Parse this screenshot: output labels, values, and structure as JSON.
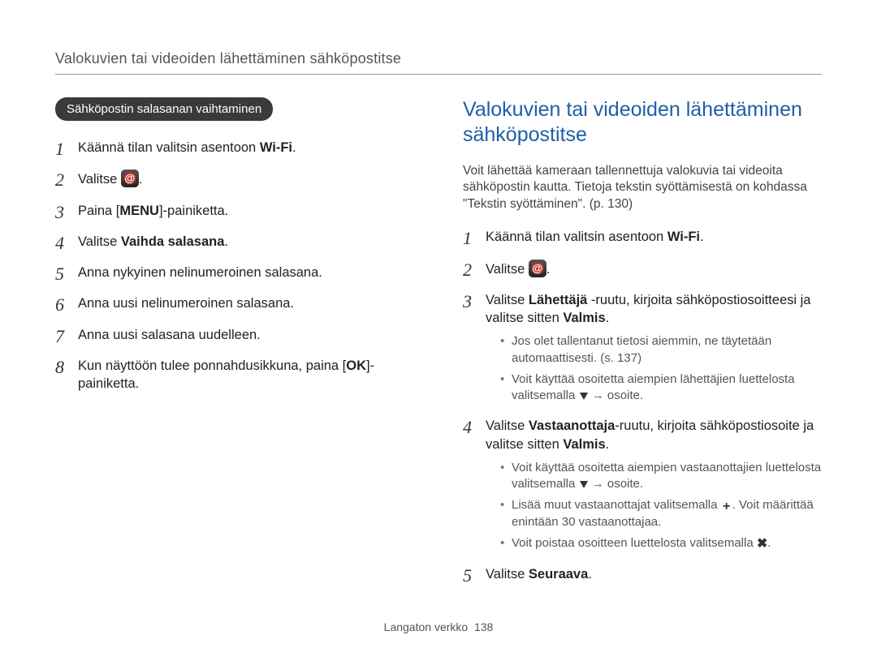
{
  "header": "Valokuvien tai videoiden lähettäminen sähköpostitse",
  "left": {
    "pill": "Sähköpostin salasanan vaihtaminen",
    "steps": {
      "s1_a": "Käännä tilan valitsin asentoon ",
      "s1_wifi": "Wi-Fi",
      "s1_b": ".",
      "s2_a": "Valitse ",
      "s2_b": ".",
      "s3_a": "Paina [",
      "s3_menu": "MENU",
      "s3_b": "]-painiketta.",
      "s4_a": "Valitse ",
      "s4_bold": "Vaihda salasana",
      "s4_b": ".",
      "s5": "Anna nykyinen nelinumeroinen salasana.",
      "s6": "Anna uusi nelinumeroinen salasana.",
      "s7": "Anna uusi salasana uudelleen.",
      "s8_a": "Kun näyttöön tulee ponnahdusikkuna, paina [",
      "s8_ok": "OK",
      "s8_b": "]-painiketta."
    }
  },
  "right": {
    "title": "Valokuvien tai videoiden lähettäminen sähköpostitse",
    "intro": "Voit lähettää kameraan tallennettuja valokuvia tai videoita sähköpostin kautta. Tietoja tekstin syöttämisestä on kohdassa \"Tekstin syöttäminen\". (p. 130)",
    "steps": {
      "s1_a": "Käännä tilan valitsin asentoon ",
      "s1_wifi": "Wi-Fi",
      "s1_b": ".",
      "s2_a": "Valitse ",
      "s2_b": ".",
      "s3_a": "Valitse ",
      "s3_bold1": "Lähettäjä",
      "s3_b": " -ruutu, kirjoita sähköpostiosoitteesi ja valitse sitten ",
      "s3_bold2": "Valmis",
      "s3_c": ".",
      "s3_sub1": "Jos olet tallentanut tietosi aiemmin, ne täytetään automaattisesti. (s. 137)",
      "s3_sub2_a": "Voit käyttää osoitetta aiempien lähettäjien luettelosta valitsemalla ",
      "s3_sub2_b": " → osoite.",
      "s4_a": "Valitse ",
      "s4_bold1": "Vastaanottaja",
      "s4_b": "-ruutu, kirjoita sähköpostiosoite ja valitse sitten ",
      "s4_bold2": "Valmis",
      "s4_c": ".",
      "s4_sub1_a": "Voit käyttää osoitetta aiempien vastaanottajien luettelosta valitsemalla ",
      "s4_sub1_b": " → osoite.",
      "s4_sub2_a": "Lisää muut vastaanottajat valitsemalla ",
      "s4_sub2_b": ". Voit määrittää enintään 30 vastaanottajaa.",
      "s4_sub3_a": "Voit poistaa osoitteen luettelosta valitsemalla ",
      "s4_sub3_b": ".",
      "s5_a": "Valitse ",
      "s5_bold": "Seuraava",
      "s5_b": "."
    }
  },
  "footer_a": "Langaton verkko",
  "footer_page": "138"
}
